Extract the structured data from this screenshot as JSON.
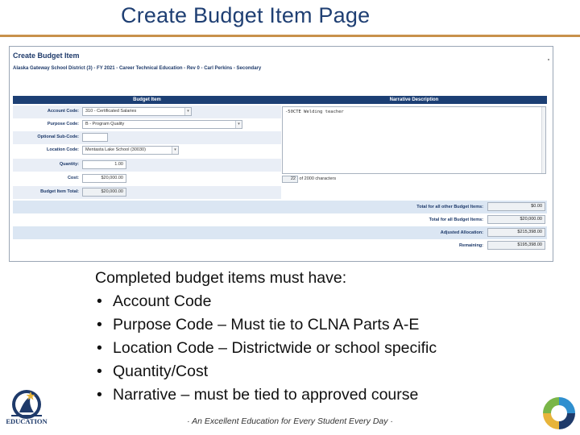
{
  "slide": {
    "title": "Create Budget Item Page",
    "footer": "· An Excellent Education for Every Student Every Day ·",
    "logo_text": "EDUCATION",
    "accent_color": "#c8914b",
    "title_color": "#1f3f73"
  },
  "screenshot": {
    "title": "Create Budget Item",
    "subtitle": "Alaska Gateway School District (3) - FY 2021 - Career Technical Education - Rev 0 - Carl Perkins - Secondary",
    "headers": {
      "budget_item": "Budget Item",
      "narrative": "Narrative Description"
    },
    "form": {
      "account_code": {
        "label": "Account Code:",
        "value": "310 - Certificated Salaries"
      },
      "purpose_code": {
        "label": "Purpose Code:",
        "value": "B - Program Quality"
      },
      "sub_code": {
        "label": "Optional Sub-Code:",
        "value": ""
      },
      "location_code": {
        "label": "Location Code:",
        "value": "Mentasta Lake School (30030)"
      },
      "quantity": {
        "label": "Quantity:",
        "value": "1.00"
      },
      "cost": {
        "label": "Cost:",
        "value": "$20,000.00"
      },
      "total": {
        "label": "Budget Item Total:",
        "value": "$20,000.00"
      }
    },
    "narrative": {
      "value": "-50CTE Welding teacher",
      "char_count": "22",
      "char_suffix": "of 2000 characters"
    },
    "summary": [
      {
        "label": "Total for all other Budget Items:",
        "value": "$0.00"
      },
      {
        "label": "Total for all Budget Items:",
        "value": "$20,000.00"
      },
      {
        "label": "Adjusted Allocation:",
        "value": "$215,398.00"
      },
      {
        "label": "Remaining:",
        "value": "$195,398.00"
      }
    ]
  },
  "requirements": {
    "intro": "Completed budget items must have:",
    "items": [
      "Account Code",
      "Purpose Code – Must tie to CLNA Parts A-E",
      "Location Code – Districtwide or school specific",
      "Quantity/Cost",
      "Narrative – must be tied to approved course"
    ]
  }
}
